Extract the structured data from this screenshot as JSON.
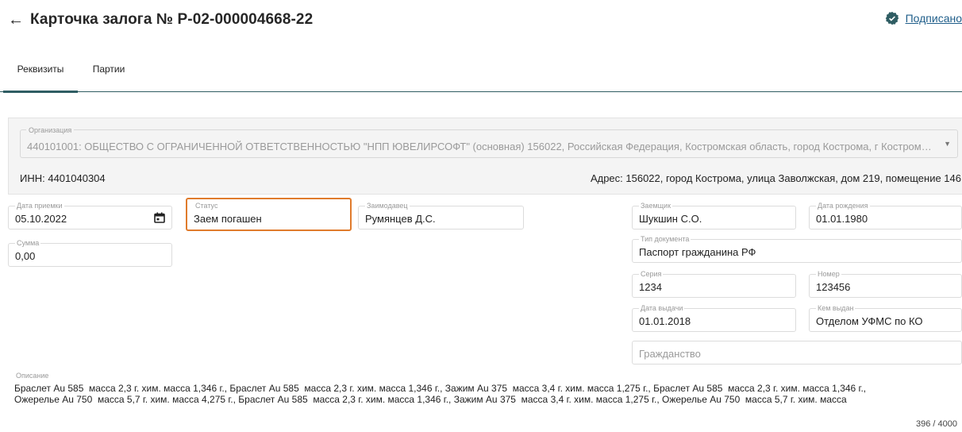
{
  "header": {
    "back_icon": "arrow-left-icon",
    "title": "Карточка залога № Р-02-000004668-22",
    "signed_icon": "verified-check-icon",
    "signed_label": "Подписано"
  },
  "tabs": [
    {
      "label": "Реквизиты",
      "active": true
    },
    {
      "label": "Партии",
      "active": false
    }
  ],
  "organization": {
    "label": "Организация",
    "value": "440101001: ОБЩЕСТВО С ОГРАНИЧЕННОЙ ОТВЕТСТВЕННОСТЬЮ \"НПП ЮВЕЛИРСОФТ\" (основная) 156022, Российская Федерация, Костромская область, город Кострома, г Костром…",
    "inn": "ИНН: 4401040304",
    "address": "Адрес: 156022, город Кострома, улица Заволжская, дом 219, помещение 146"
  },
  "fields": {
    "date_received": {
      "label": "Дата приемки",
      "value": "05.10.2022"
    },
    "status": {
      "label": "Статус",
      "value": "Заем погашен"
    },
    "lender": {
      "label": "Заимодавец",
      "value": "Румянцев Д.С."
    },
    "sum": {
      "label": "Сумма",
      "value": "0,00"
    },
    "borrower": {
      "label": "Заемщик",
      "value": "Шукшин С.О."
    },
    "birth_date": {
      "label": "Дата рождения",
      "value": "01.01.1980"
    },
    "doc_type": {
      "label": "Тип документа",
      "value": "Паспорт гражданина РФ"
    },
    "series": {
      "label": "Серия",
      "value": "1234"
    },
    "number": {
      "label": "Номер",
      "value": "123456"
    },
    "issue_date": {
      "label": "Дата выдачи",
      "value": "01.01.2018"
    },
    "issued_by": {
      "label": "Кем выдан",
      "value": "Отделом УФМС по КО"
    },
    "citizenship": {
      "placeholder": "Гражданство"
    }
  },
  "description": {
    "label": "Описание",
    "text": "Браслет Au 585  масса 2,3 г. хим. масса 1,346 г., Браслет Au 585  масса 2,3 г. хим. масса 1,346 г., Зажим Au 375  масса 3,4 г. хим. масса 1,275 г., Браслет Au 585  масса 2,3 г. хим. масса 1,346 г.,\nОжерелье Au 750  масса 5,7 г. хим. масса 4,275 г., Браслет Au 585  масса 2,3 г. хим. масса 1,346 г., Зажим Au 375  масса 3,4 г. хим. масса 1,275 г., Ожерелье Au 750  масса 5,7 г. хим. масса",
    "counter": "396 / 4000"
  },
  "colors": {
    "accent": "#2f5d63",
    "status_highlight": "#e07b2c",
    "link": "#1f5e8a"
  }
}
